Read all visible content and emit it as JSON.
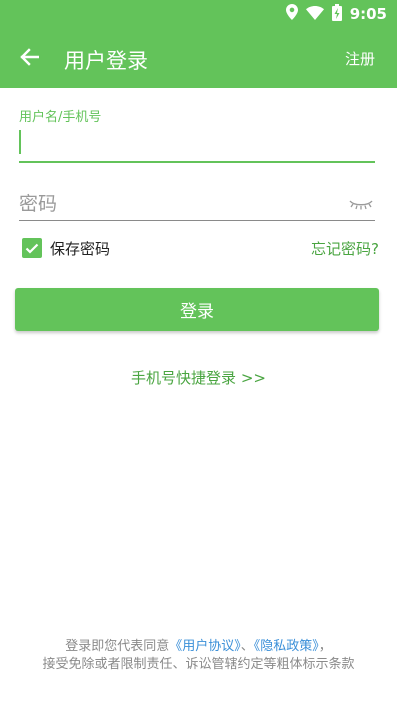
{
  "status_bar": {
    "time": "9:05",
    "icons": [
      "location-icon",
      "wifi-icon",
      "battery-charging-icon"
    ]
  },
  "toolbar": {
    "back_icon": "arrow-left-icon",
    "title": "用户登录",
    "register_label": "注册"
  },
  "form": {
    "username": {
      "label": "用户名/手机号",
      "value": ""
    },
    "password": {
      "placeholder": "密码",
      "value": "",
      "toggle_icon": "eye-closed-icon"
    },
    "remember": {
      "label": "保存密码",
      "checked": true
    },
    "forgot_label": "忘记密码?",
    "login_label": "登录"
  },
  "quick_login_label": "手机号快捷登录 >>",
  "terms": {
    "prefix": "登录即您代表同意",
    "user_agreement": "《用户协议》",
    "separator": "、",
    "privacy_policy": "《隐私政策》",
    "comma": "，",
    "line2": "接受免除或者限制责任、诉讼管辖约定等粗体标示条款"
  },
  "colors": {
    "primary": "#63c35a",
    "link_green": "#4aa541",
    "link_blue": "#3a8fd8",
    "muted_text": "#8a8a8a"
  }
}
